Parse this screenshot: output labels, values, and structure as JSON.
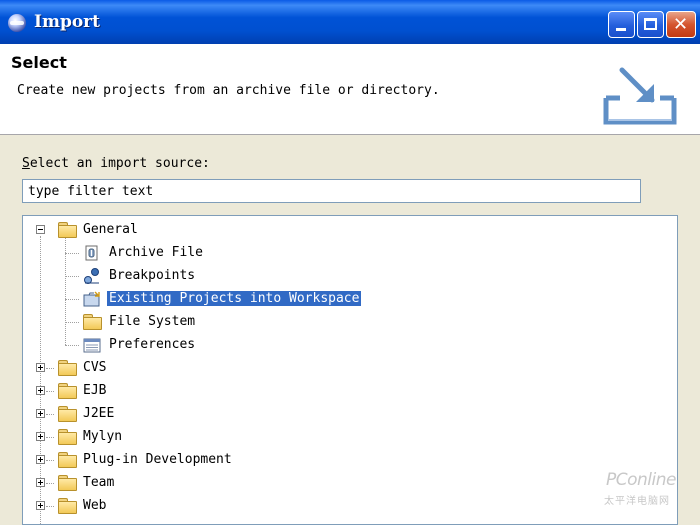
{
  "window": {
    "title": "Import"
  },
  "header": {
    "title": "Select",
    "description": "Create new projects from an archive file or directory."
  },
  "source": {
    "label_first": "S",
    "label_rest": "elect an import source:",
    "filter_value": "type filter text"
  },
  "tree": {
    "general": {
      "label": "General",
      "children": [
        {
          "label": "Archive File",
          "icon": "archive-file-icon"
        },
        {
          "label": "Breakpoints",
          "icon": "breakpoints-icon"
        },
        {
          "label": "Existing Projects into Workspace",
          "icon": "existing-projects-icon",
          "selected": true
        },
        {
          "label": "File System",
          "icon": "folder-icon"
        },
        {
          "label": "Preferences",
          "icon": "preferences-icon"
        }
      ]
    },
    "categories": [
      "CVS",
      "EJB",
      "J2EE",
      "Mylyn",
      "Plug-in Development",
      "Team",
      "Web"
    ]
  },
  "watermark": {
    "brand": "PConline",
    "sub": "太平洋电脑网"
  },
  "colors": {
    "selection": "#316ac5",
    "titlebar": "#0054e3"
  }
}
